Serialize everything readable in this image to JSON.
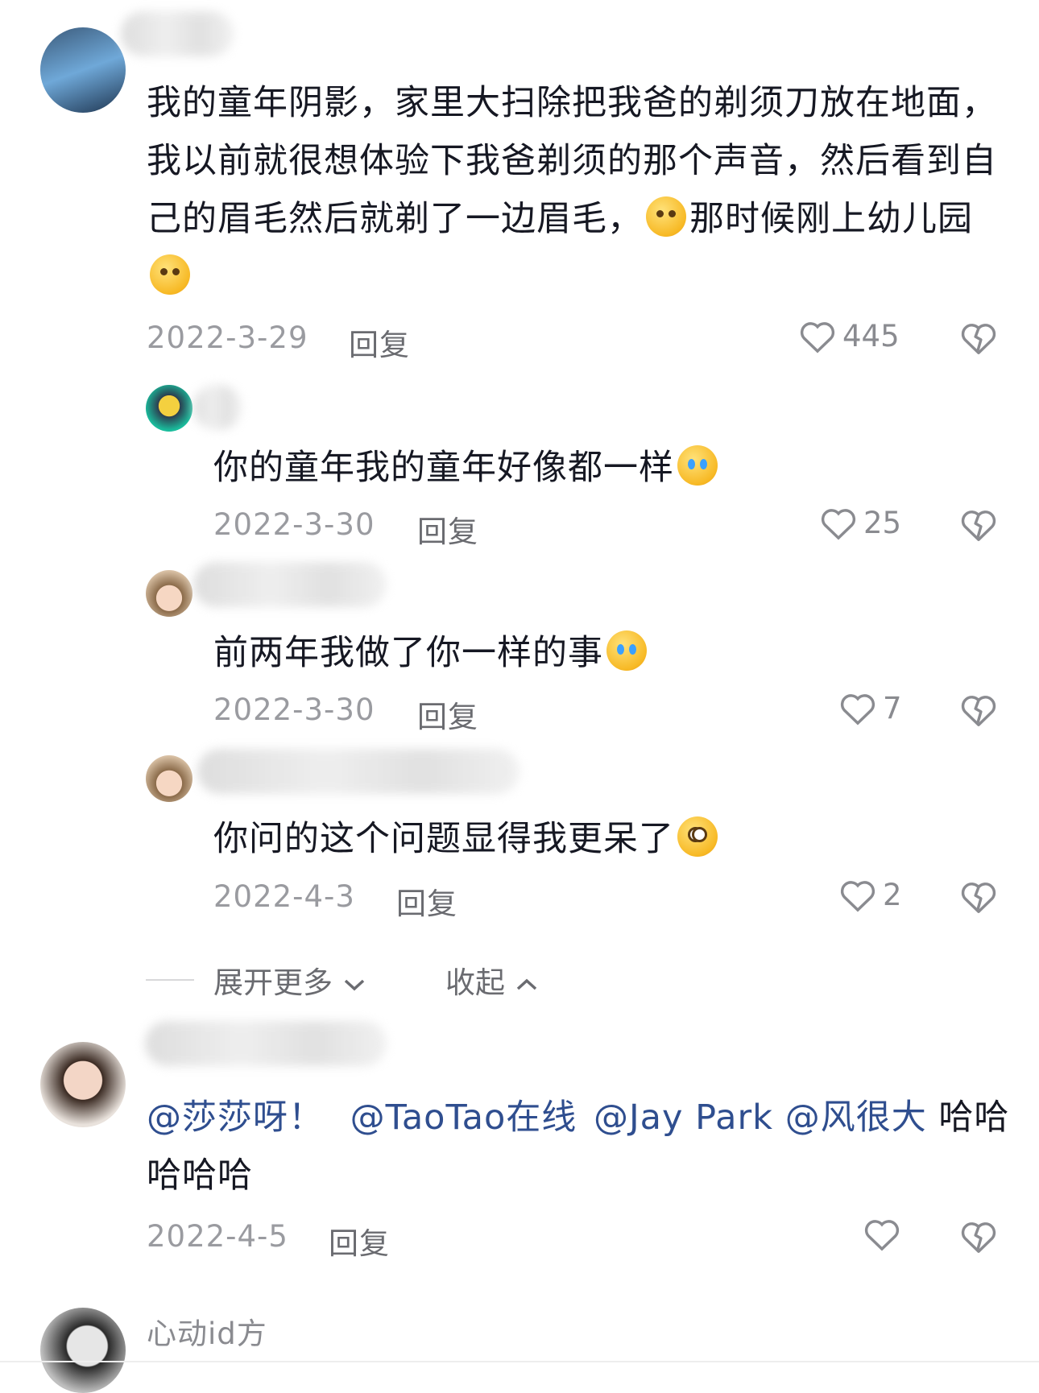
{
  "comments": [
    {
      "lines": [
        "我的童年阴影，家里大扫除把我爸的剃须刀放在地面，",
        "我以前就很想体验下我爸剃须的那个声音，然后看到自",
        "己的眉毛然后就剃了一边眉毛，",
        "那时候刚上幼儿园"
      ],
      "date": "2022-3-29",
      "reply": "回复",
      "likes": "445"
    },
    {
      "text": "你的童年我的童年好像都一样",
      "date": "2022-3-30",
      "reply": "回复",
      "likes": "25"
    },
    {
      "text": "前两年我做了你一样的事",
      "date": "2022-3-30",
      "reply": "回复",
      "likes": "7"
    },
    {
      "text": "你问的这个问题显得我更呆了",
      "date": "2022-4-3",
      "reply": "回复",
      "likes": "2"
    },
    {
      "mentions": [
        "@莎莎呀！",
        "@TaoTao在线",
        "@Jay Park",
        "@风很大"
      ],
      "text_after": "哈哈",
      "line2": "哈哈哈",
      "date": "2022-4-5",
      "reply": "回复",
      "likes": ""
    }
  ],
  "thread_controls": {
    "expand": "展开更多",
    "collapse": "收起"
  },
  "next_user": {
    "name": "心动id方"
  },
  "icons": [
    "heart-icon",
    "dislike-heart-icon",
    "chevron-down-icon",
    "chevron-up-icon"
  ],
  "colors": {
    "mention": "#2f4e8f",
    "meta": "#9a9ba0",
    "text": "#161823"
  }
}
